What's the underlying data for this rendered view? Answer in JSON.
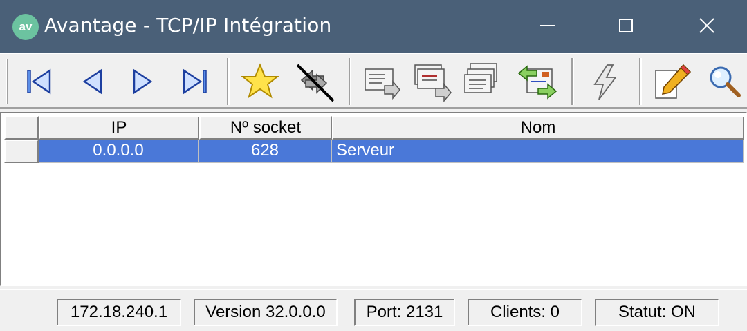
{
  "window": {
    "logo_text": "av",
    "title": "Avantage - TCP/IP Intégration"
  },
  "toolbar": {
    "buttons": [
      {
        "name": "first-record",
        "icon": "first-icon"
      },
      {
        "name": "previous-record",
        "icon": "previous-icon"
      },
      {
        "name": "next-record",
        "icon": "next-icon"
      },
      {
        "name": "last-record",
        "icon": "last-icon"
      },
      {
        "name": "favorite",
        "icon": "star-icon"
      },
      {
        "name": "disconnect",
        "icon": "disconnect-icon"
      },
      {
        "name": "send-message",
        "icon": "mail-send-icon"
      },
      {
        "name": "send-multiple",
        "icon": "mail-multi-icon"
      },
      {
        "name": "send-all",
        "icon": "mail-stack-icon"
      },
      {
        "name": "exchange",
        "icon": "mail-exchange-icon"
      },
      {
        "name": "trigger",
        "icon": "lightning-icon"
      },
      {
        "name": "edit",
        "icon": "pencil-icon"
      },
      {
        "name": "search",
        "icon": "magnifier-icon"
      }
    ]
  },
  "grid": {
    "columns": [
      "IP",
      "Nº socket",
      "Nom"
    ],
    "rows": [
      {
        "ip": "0.0.0.0",
        "socket": "628",
        "nom": "Serveur"
      }
    ],
    "selection_color": "#4a78d8"
  },
  "status": {
    "ip": "172.18.240.1",
    "version": "Version 32.0.0.0",
    "port": "Port: 2131",
    "clients": "Clients: 0",
    "statut": "Statut: ON"
  },
  "colors": {
    "titlebar": "#4a6078",
    "logo": "#6cc3a0"
  }
}
